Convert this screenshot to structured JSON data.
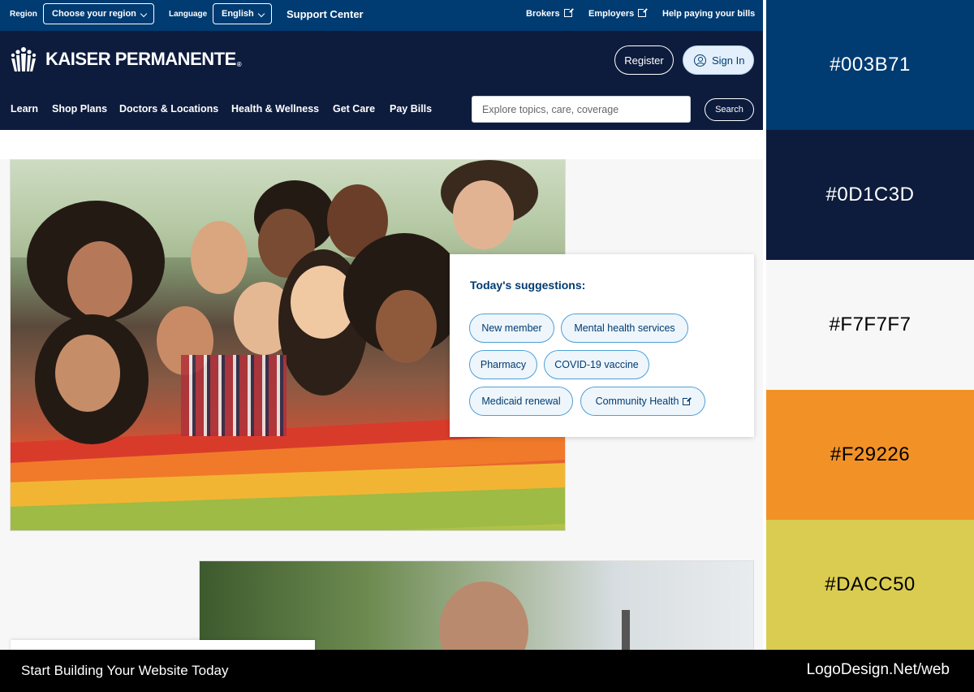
{
  "utility_bar": {
    "region_label": "Region",
    "region_value": "Choose your region",
    "language_label": "Language",
    "language_value": "English",
    "support_center": "Support Center",
    "links": [
      "Brokers",
      "Employers",
      "Help paying your bills"
    ]
  },
  "header": {
    "logo_text": "KAISER PERMANENTE",
    "logo_reg": "®",
    "register_label": "Register",
    "signin_label": "Sign In"
  },
  "nav": {
    "items": [
      "Learn",
      "Shop Plans",
      "Doctors & Locations",
      "Health & Wellness",
      "Get Care",
      "Pay Bills"
    ],
    "search_placeholder": "Explore topics, care, coverage",
    "search_button": "Search"
  },
  "suggestions": {
    "title": "Today's suggestions:",
    "chips": [
      "New member",
      "Mental health services",
      "Pharmacy",
      "COVID-19 vaccine",
      "Medicaid renewal",
      "Community Health"
    ]
  },
  "palette": [
    {
      "hex": "#003B71",
      "text_color": "#ffffff"
    },
    {
      "hex": "#0D1C3D",
      "text_color": "#ffffff"
    },
    {
      "hex": "#F7F7F7",
      "text_color": "#000000"
    },
    {
      "hex": "#F29226",
      "text_color": "#000000"
    },
    {
      "hex": "#DACC50",
      "text_color": "#000000"
    }
  ],
  "footer": {
    "left": "Start Building Your Website Today",
    "right": "LogoDesign.Net/web"
  },
  "colors": {
    "primary_blue": "#003b71",
    "navy": "#0d1c3d",
    "background": "#f7f7f7",
    "orange": "#f29226",
    "yellow": "#dacc50"
  }
}
